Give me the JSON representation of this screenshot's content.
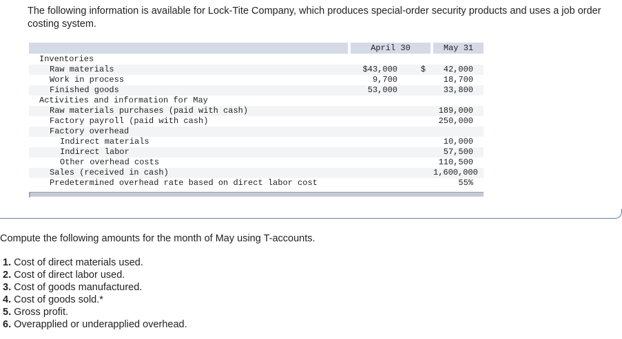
{
  "intro": "The following information is available for Lock-Tite Company, which produces special-order security products and uses a job order costing system.",
  "table": {
    "col_april": "April 30",
    "col_may": "May 31",
    "rows": [
      {
        "label": "Inventories",
        "indent": 1,
        "april": "",
        "dollar": "",
        "may": ""
      },
      {
        "label": "Raw materials",
        "indent": 2,
        "april": "$43,000",
        "dollar": "$",
        "may": "42,000"
      },
      {
        "label": "Work in process",
        "indent": 2,
        "april": "9,700",
        "dollar": "",
        "may": "18,700"
      },
      {
        "label": "Finished goods",
        "indent": 2,
        "april": "53,000",
        "dollar": "",
        "may": "33,800"
      },
      {
        "label": "Activities and information for May",
        "indent": 1,
        "april": "",
        "dollar": "",
        "may": ""
      },
      {
        "label": "Raw materials purchases (paid with cash)",
        "indent": 2,
        "april": "",
        "dollar": "",
        "may": "189,000"
      },
      {
        "label": "Factory payroll (paid with cash)",
        "indent": 2,
        "april": "",
        "dollar": "",
        "may": "250,000"
      },
      {
        "label": "Factory overhead",
        "indent": 2,
        "april": "",
        "dollar": "",
        "may": ""
      },
      {
        "label": "Indirect materials",
        "indent": 3,
        "april": "",
        "dollar": "",
        "may": "10,000"
      },
      {
        "label": "Indirect labor",
        "indent": 3,
        "april": "",
        "dollar": "",
        "may": "57,500"
      },
      {
        "label": "Other overhead costs",
        "indent": 3,
        "april": "",
        "dollar": "",
        "may": "110,500"
      },
      {
        "label": "Sales (received in cash)",
        "indent": 2,
        "april": "",
        "dollar": "",
        "may": "1,600,000"
      },
      {
        "label": "Predetermined overhead rate based on direct labor cost",
        "indent": 2,
        "april": "",
        "dollar": "",
        "may": "55%"
      }
    ]
  },
  "question": "Compute the following amounts for the month of May using T-accounts.",
  "items": [
    {
      "num": "1.",
      "text": "Cost of direct materials used."
    },
    {
      "num": "2.",
      "text": "Cost of direct labor used."
    },
    {
      "num": "3.",
      "text": "Cost of goods manufactured."
    },
    {
      "num": "4.",
      "text": "Cost of goods sold.*"
    },
    {
      "num": "5.",
      "text": "Gross profit."
    },
    {
      "num": "6.",
      "text": "Overapplied or underapplied overhead."
    }
  ]
}
